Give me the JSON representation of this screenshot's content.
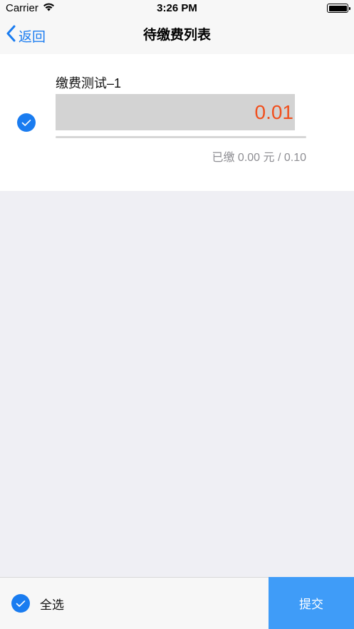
{
  "status_bar": {
    "carrier": "Carrier",
    "time": "3:26 PM"
  },
  "nav": {
    "back_label": "返回",
    "title": "待缴费列表"
  },
  "items": [
    {
      "name": "缴费测试–1",
      "amount_input": "0.01",
      "paid_text": "已缴 0.00 元 / 0.10",
      "checked": true
    }
  ],
  "footer": {
    "select_all_label": "全选",
    "submit_label": "提交"
  },
  "colors": {
    "accent": "#1a7cf0",
    "amount": "#f0501e",
    "submit_bg": "#3f9cf8",
    "page_bg": "#efeff4"
  },
  "icons": [
    "wifi-icon",
    "battery-icon",
    "back-chevron-icon",
    "check-icon"
  ]
}
